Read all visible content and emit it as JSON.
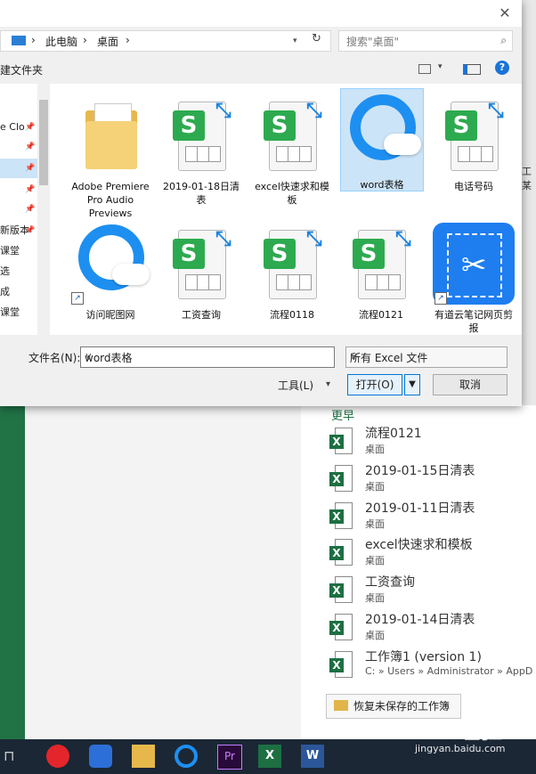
{
  "dialog": {
    "close_glyph": "✕",
    "breadcrumb": [
      "此电脑",
      "桌面"
    ],
    "crumb_sep": "›",
    "search_placeholder": "搜索\"桌面\"",
    "toolbar_label": "建文件夹",
    "help_glyph": "?",
    "nav_items": [
      {
        "label": "e Clo",
        "pinned": true
      },
      {
        "label": "",
        "pinned": true
      },
      {
        "label": "",
        "pinned": true
      },
      {
        "label": "",
        "pinned": true
      },
      {
        "label": "",
        "pinned": true
      },
      {
        "label": "新版本",
        "pinned": true
      },
      {
        "label": "课堂",
        "pinned": false
      },
      {
        "label": "选",
        "pinned": false
      },
      {
        "label": "成",
        "pinned": false
      },
      {
        "label": "课堂",
        "pinned": false
      }
    ],
    "files": [
      {
        "name": "Adobe Premiere Pro Audio Previews",
        "kind": "folder"
      },
      {
        "name": "2019-01-18日清表",
        "kind": "sheet"
      },
      {
        "name": "excel快速求和模板",
        "kind": "sheet"
      },
      {
        "name": "word表格",
        "kind": "qq",
        "selected": true
      },
      {
        "name": "电话号码",
        "kind": "sheet"
      },
      {
        "name": "访问昵图网",
        "kind": "qq-shortcut"
      },
      {
        "name": "工资查询",
        "kind": "sheet"
      },
      {
        "name": "流程0118",
        "kind": "sheet"
      },
      {
        "name": "流程0121",
        "kind": "sheet"
      },
      {
        "name": "有道云笔记网页剪报",
        "kind": "scissor-shortcut"
      }
    ],
    "filename_label": "文件名(N):",
    "filename_value": "word表格",
    "filetype_value": "所有 Excel 文件",
    "tools_label": "工具(L)",
    "open_label": "打开(O)",
    "cancel_label": "取消",
    "right_cut": "工某"
  },
  "excel": {
    "section_label": "更早",
    "recent": [
      {
        "name": "流程0121",
        "location": "桌面"
      },
      {
        "name": "2019-01-15日清表",
        "location": "桌面"
      },
      {
        "name": "2019-01-11日清表",
        "location": "桌面"
      },
      {
        "name": "excel快速求和模板",
        "location": "桌面"
      },
      {
        "name": "工资查询",
        "location": "桌面"
      },
      {
        "name": "2019-01-14日清表",
        "location": "桌面"
      },
      {
        "name": "工作簿1 (version 1)",
        "location": "C: » Users » Administrator » AppD"
      }
    ],
    "recover_label": "恢复未保存的工作簿"
  },
  "watermark": {
    "brand": "Bai 经验",
    "url": "jingyan.baidu.com"
  },
  "colors": {
    "excel_green": "#217346",
    "wps_green": "#2daa4f",
    "accent_blue": "#1a83e0",
    "taskbar": "#1b2735"
  }
}
